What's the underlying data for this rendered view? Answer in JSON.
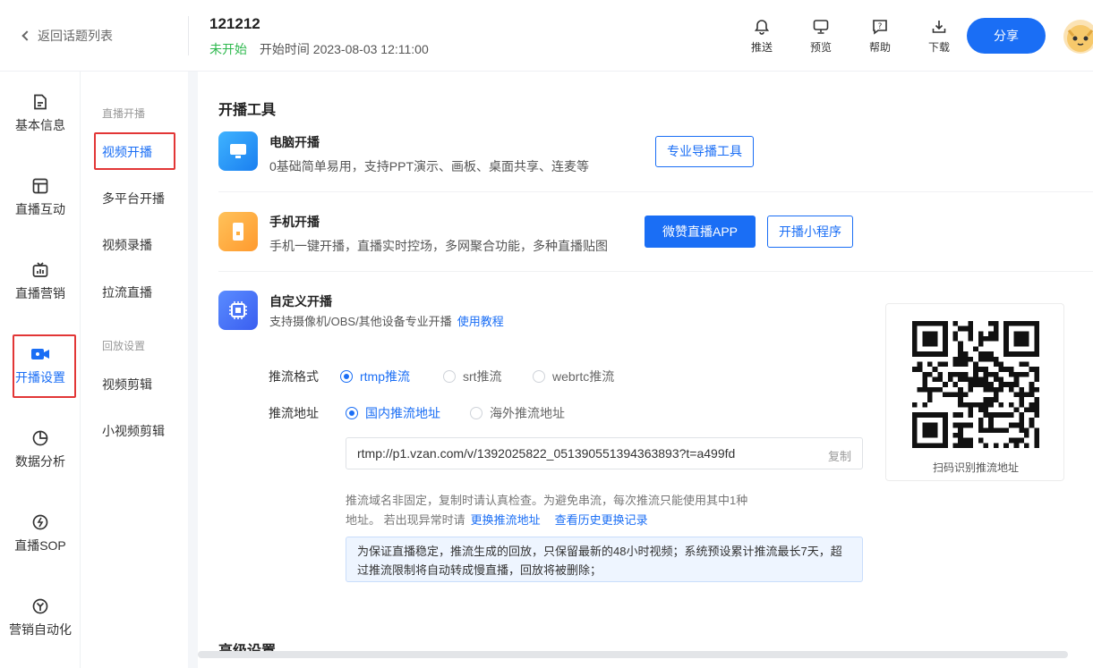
{
  "header": {
    "back_label": "返回话题列表",
    "title": "121212",
    "status": "未开始",
    "start_time": "开始时间 2023-08-03 12:11:00",
    "tools": [
      {
        "label": "推送",
        "icon": "bell-icon"
      },
      {
        "label": "预览",
        "icon": "monitor-icon"
      },
      {
        "label": "帮助",
        "icon": "help-icon"
      },
      {
        "label": "下载",
        "icon": "download-icon"
      }
    ],
    "share_label": "分享"
  },
  "leftnav": {
    "items": [
      {
        "label": "基本信息",
        "icon": "document-icon"
      },
      {
        "label": "直播互动",
        "icon": "layout-icon"
      },
      {
        "label": "直播营销",
        "icon": "tv-chart-icon"
      },
      {
        "label": "开播设置",
        "icon": "camera-icon"
      },
      {
        "label": "数据分析",
        "icon": "pie-chart-icon"
      },
      {
        "label": "直播SOP",
        "icon": "gauge-icon"
      },
      {
        "label": "营销自动化",
        "icon": "automation-icon"
      }
    ],
    "active_index": 3
  },
  "subnav": {
    "group1": "直播开播",
    "items1": [
      "视频开播",
      "多平台开播",
      "视频录播",
      "拉流直播"
    ],
    "group2": "回放设置",
    "items2": [
      "视频剪辑",
      "小视频剪辑"
    ]
  },
  "main": {
    "section_title": "开播工具",
    "pc": {
      "name": "电脑开播",
      "desc": "0基础简单易用，支持PPT演示、画板、桌面共享、连麦等",
      "button": "专业导播工具"
    },
    "mobile": {
      "name": "手机开播",
      "desc": "手机一键开播，直播实时控场，多网聚合功能，多种直播贴图",
      "button_primary": "微赞直播APP",
      "button_secondary": "开播小程序"
    },
    "custom": {
      "name": "自定义开播",
      "desc": "支持摄像机/OBS/其他设备专业开播",
      "tutorial_link": "使用教程"
    },
    "stream_format": {
      "label": "推流格式",
      "options": [
        "rtmp推流",
        "srt推流",
        "webrtc推流"
      ],
      "selected": "rtmp推流"
    },
    "stream_address": {
      "label": "推流地址",
      "options": [
        "国内推流地址",
        "海外推流地址"
      ],
      "selected": "国内推流地址"
    },
    "url": "rtmp://p1.vzan.com/v/1392025822_051390551394363893?t=a499fd",
    "copy_label": "复制",
    "note_line1": "推流域名非固定，复制时请认真检查。为避免串流，每次推流只能使用其中1种",
    "note_line2": "地址。 若出现异常时请",
    "note_link1": "更换推流地址",
    "note_link2": "查看历史更换记录",
    "info_text": "为保证直播稳定，推流生成的回放，只保留最新的48小时视频；系统预设累计推流最长7天，超过推流限制将自动转成慢直播，回放将被删除；",
    "qr_label": "扫码识别推流地址",
    "advanced_title": "高级设置"
  },
  "colors": {
    "accent": "#1a6ef5",
    "status_green": "#2db84d",
    "highlight_red": "#e23636"
  }
}
